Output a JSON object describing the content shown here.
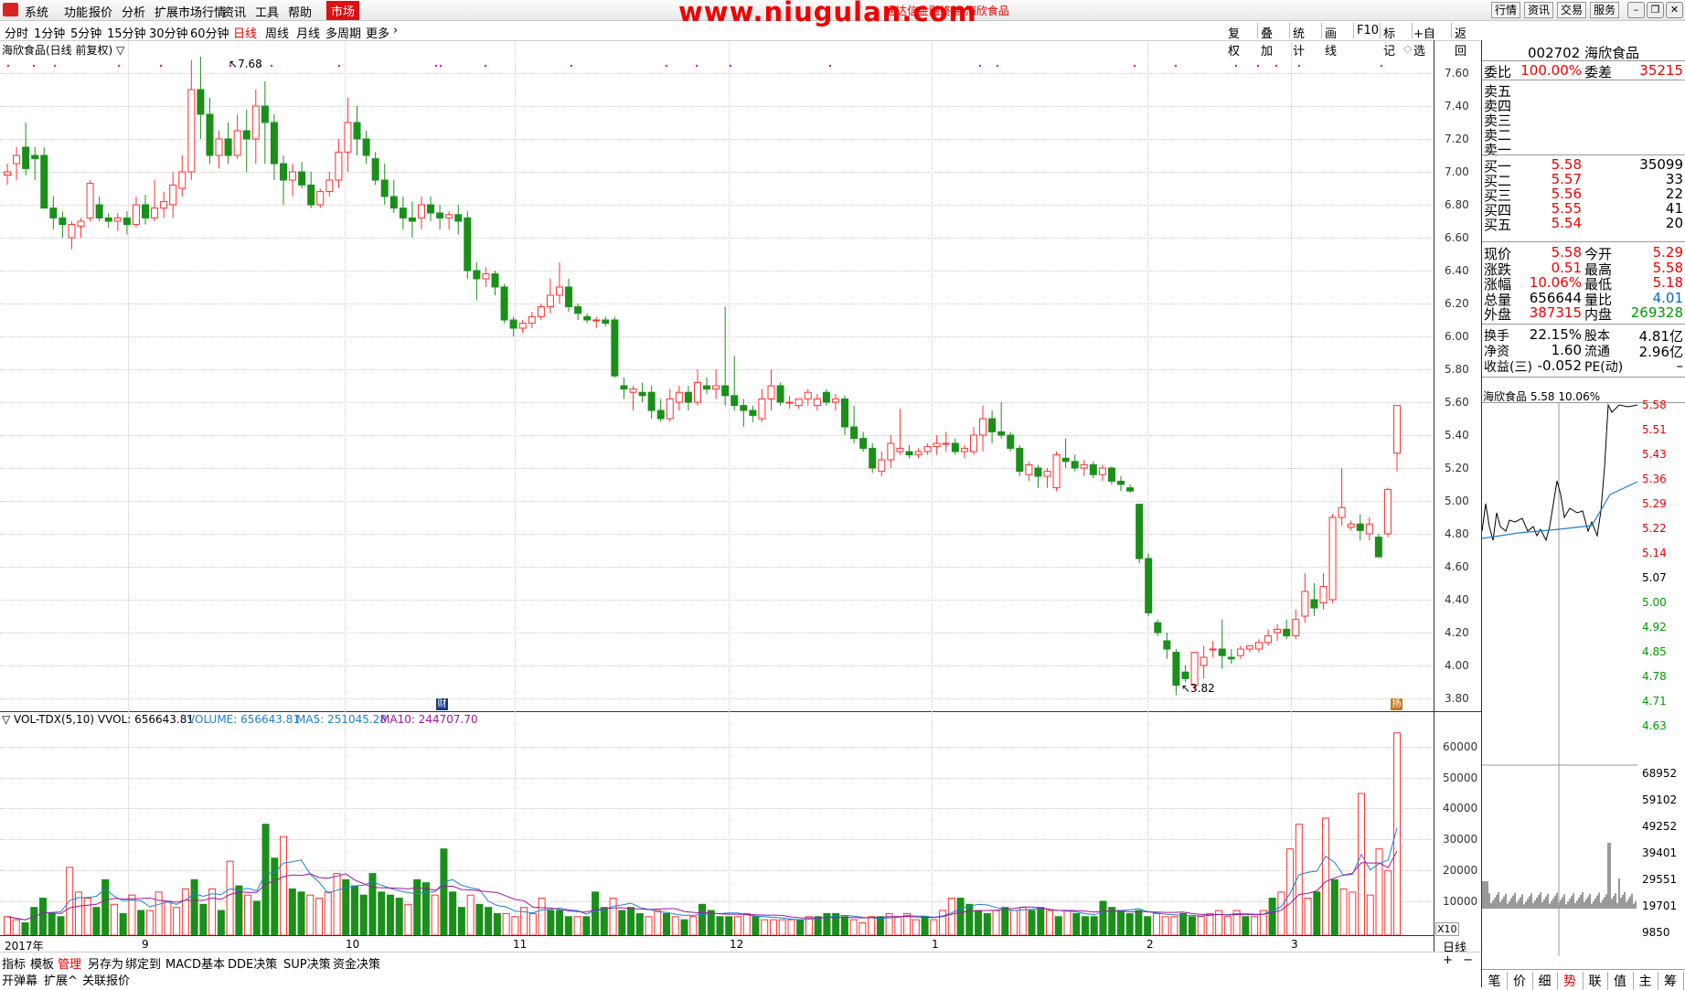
{
  "menu": {
    "items": [
      "系统",
      "功能",
      "报价",
      "分析",
      "扩展市场行情",
      "资讯",
      "工具",
      "帮助"
    ],
    "market": "市场",
    "watermark": "www.niugulan.com",
    "window_title": "通达信金融终端 海欣食品",
    "right_buttons": [
      "行情",
      "资讯",
      "交易",
      "服务"
    ]
  },
  "periods": {
    "items": [
      "分时",
      "1分钟",
      "5分钟",
      "15分钟",
      "30分钟",
      "60分钟",
      "日线",
      "周线",
      "月线",
      "多周期",
      "更多"
    ],
    "active": "日线"
  },
  "toolbar_right": [
    "复权",
    "叠加",
    "统计",
    "画线",
    "F10",
    "标记",
    "+自选",
    "返回"
  ],
  "main_chart": {
    "title": "海欣食品(日线 前复权) ▽",
    "high_label": "7.68",
    "low_label": "3.82",
    "y_ticks": [
      "7.60",
      "7.40",
      "7.20",
      "7.00",
      "6.80",
      "6.60",
      "6.40",
      "6.20",
      "6.00",
      "5.80",
      "5.60",
      "5.40",
      "5.20",
      "5.00",
      "4.80",
      "4.60",
      "4.40",
      "4.20",
      "4.00",
      "3.80"
    ],
    "badge1": "财",
    "badge2": "扬"
  },
  "chart_data": [
    {
      "type": "candlestick",
      "title": "海欣食品(日线 前复权)",
      "ylim": [
        3.75,
        7.72
      ],
      "candles": [
        [
          6.98,
          7.05,
          6.92,
          7.0
        ],
        [
          7.05,
          7.15,
          6.95,
          7.1
        ],
        [
          7.15,
          7.3,
          6.98,
          7.02
        ],
        [
          7.1,
          7.15,
          6.95,
          7.08
        ],
        [
          7.1,
          7.15,
          6.9,
          6.78
        ],
        [
          6.78,
          6.85,
          6.65,
          6.72
        ],
        [
          6.72,
          6.76,
          6.6,
          6.68
        ],
        [
          6.6,
          6.7,
          6.53,
          6.68
        ],
        [
          6.67,
          6.72,
          6.6,
          6.7
        ],
        [
          6.72,
          6.95,
          6.7,
          6.93
        ],
        [
          6.8,
          6.85,
          6.7,
          6.72
        ],
        [
          6.72,
          6.75,
          6.66,
          6.7
        ],
        [
          6.7,
          6.75,
          6.64,
          6.72
        ],
        [
          6.72,
          6.76,
          6.62,
          6.68
        ],
        [
          6.68,
          6.85,
          6.66,
          6.8
        ],
        [
          6.8,
          6.86,
          6.68,
          6.72
        ],
        [
          6.72,
          6.95,
          6.7,
          6.78
        ],
        [
          6.78,
          6.88,
          6.72,
          6.82
        ],
        [
          6.8,
          7.0,
          6.72,
          6.92
        ],
        [
          6.9,
          7.1,
          6.85,
          7.0
        ],
        [
          7.0,
          7.68,
          6.95,
          7.5
        ],
        [
          7.5,
          7.7,
          7.2,
          7.35
        ],
        [
          7.35,
          7.45,
          7.05,
          7.1
        ],
        [
          7.1,
          7.25,
          7.02,
          7.2
        ],
        [
          7.2,
          7.3,
          7.05,
          7.1
        ],
        [
          7.1,
          7.35,
          7.08,
          7.25
        ],
        [
          7.25,
          7.38,
          7.0,
          7.2
        ],
        [
          7.2,
          7.5,
          7.05,
          7.4
        ],
        [
          7.4,
          7.55,
          7.05,
          7.3
        ],
        [
          7.3,
          7.35,
          6.95,
          7.05
        ],
        [
          7.05,
          7.1,
          6.8,
          6.95
        ],
        [
          6.95,
          7.05,
          6.85,
          7.0
        ],
        [
          7.0,
          7.06,
          6.9,
          6.92
        ],
        [
          6.92,
          7.0,
          6.78,
          6.8
        ],
        [
          6.8,
          6.9,
          6.78,
          6.88
        ],
        [
          6.88,
          7.0,
          6.85,
          6.95
        ],
        [
          6.95,
          7.2,
          6.9,
          7.12
        ],
        [
          7.12,
          7.45,
          7.0,
          7.3
        ],
        [
          7.3,
          7.4,
          7.1,
          7.2
        ],
        [
          7.2,
          7.25,
          7.05,
          7.1
        ],
        [
          7.08,
          7.12,
          6.92,
          6.95
        ],
        [
          6.95,
          7.05,
          6.8,
          6.85
        ],
        [
          6.85,
          6.95,
          6.75,
          6.78
        ],
        [
          6.78,
          6.85,
          6.65,
          6.72
        ],
        [
          6.72,
          6.82,
          6.6,
          6.7
        ],
        [
          6.72,
          6.85,
          6.65,
          6.8
        ],
        [
          6.8,
          6.85,
          6.7,
          6.75
        ],
        [
          6.75,
          6.8,
          6.65,
          6.72
        ],
        [
          6.72,
          6.76,
          6.65,
          6.74
        ],
        [
          6.74,
          6.8,
          6.62,
          6.7
        ],
        [
          6.72,
          6.76,
          6.35,
          6.4
        ],
        [
          6.4,
          6.45,
          6.22,
          6.35
        ],
        [
          6.35,
          6.42,
          6.3,
          6.38
        ],
        [
          6.38,
          6.4,
          6.25,
          6.3
        ],
        [
          6.3,
          6.32,
          6.08,
          6.1
        ],
        [
          6.1,
          6.12,
          6.0,
          6.05
        ],
        [
          6.05,
          6.1,
          6.02,
          6.08
        ],
        [
          6.08,
          6.15,
          6.05,
          6.12
        ],
        [
          6.12,
          6.2,
          6.1,
          6.18
        ],
        [
          6.18,
          6.35,
          6.14,
          6.25
        ],
        [
          6.25,
          6.45,
          6.2,
          6.3
        ],
        [
          6.3,
          6.35,
          6.15,
          6.18
        ],
        [
          6.18,
          6.2,
          6.1,
          6.14
        ],
        [
          6.12,
          6.14,
          6.08,
          6.1
        ],
        [
          6.1,
          6.12,
          6.05,
          6.1
        ],
        [
          6.1,
          6.12,
          6.06,
          6.08
        ],
        [
          6.1,
          6.12,
          5.75,
          5.76
        ],
        [
          5.7,
          5.75,
          5.62,
          5.68
        ],
        [
          5.66,
          5.7,
          5.55,
          5.68
        ],
        [
          5.66,
          5.72,
          5.6,
          5.64
        ],
        [
          5.66,
          5.7,
          5.5,
          5.55
        ],
        [
          5.55,
          5.62,
          5.48,
          5.5
        ],
        [
          5.5,
          5.68,
          5.48,
          5.62
        ],
        [
          5.6,
          5.7,
          5.55,
          5.66
        ],
        [
          5.66,
          5.7,
          5.55,
          5.6
        ],
        [
          5.6,
          5.8,
          5.58,
          5.72
        ],
        [
          5.7,
          5.75,
          5.65,
          5.68
        ],
        [
          5.68,
          5.8,
          5.62,
          5.7
        ],
        [
          5.7,
          6.18,
          5.58,
          5.64
        ],
        [
          5.64,
          5.88,
          5.55,
          5.58
        ],
        [
          5.58,
          5.62,
          5.45,
          5.55
        ],
        [
          5.55,
          5.58,
          5.48,
          5.52
        ],
        [
          5.5,
          5.68,
          5.48,
          5.62
        ],
        [
          5.62,
          5.8,
          5.55,
          5.7
        ],
        [
          5.7,
          5.72,
          5.58,
          5.6
        ],
        [
          5.6,
          5.64,
          5.56,
          5.6
        ],
        [
          5.58,
          5.62,
          5.56,
          5.62
        ],
        [
          5.62,
          5.68,
          5.58,
          5.66
        ],
        [
          5.58,
          5.65,
          5.55,
          5.62
        ],
        [
          5.66,
          5.68,
          5.58,
          5.6
        ],
        [
          5.6,
          5.65,
          5.55,
          5.62
        ],
        [
          5.62,
          5.64,
          5.4,
          5.45
        ],
        [
          5.45,
          5.58,
          5.35,
          5.38
        ],
        [
          5.38,
          5.42,
          5.3,
          5.32
        ],
        [
          5.32,
          5.35,
          5.17,
          5.2
        ],
        [
          5.18,
          5.3,
          5.15,
          5.25
        ],
        [
          5.25,
          5.4,
          5.2,
          5.35
        ],
        [
          5.3,
          5.56,
          5.28,
          5.32
        ],
        [
          5.3,
          5.34,
          5.26,
          5.28
        ],
        [
          5.28,
          5.32,
          5.26,
          5.3
        ],
        [
          5.3,
          5.35,
          5.28,
          5.33
        ],
        [
          5.33,
          5.4,
          5.28,
          5.35
        ],
        [
          5.35,
          5.42,
          5.3,
          5.35
        ],
        [
          5.35,
          5.38,
          5.28,
          5.3
        ],
        [
          5.3,
          5.34,
          5.26,
          5.32
        ],
        [
          5.3,
          5.45,
          5.28,
          5.4
        ],
        [
          5.4,
          5.58,
          5.3,
          5.5
        ],
        [
          5.5,
          5.55,
          5.35,
          5.42
        ],
        [
          5.42,
          5.6,
          5.38,
          5.4
        ],
        [
          5.4,
          5.42,
          5.3,
          5.32
        ],
        [
          5.32,
          5.34,
          5.15,
          5.18
        ],
        [
          5.16,
          5.24,
          5.12,
          5.22
        ],
        [
          5.2,
          5.22,
          5.08,
          5.15
        ],
        [
          5.15,
          5.2,
          5.08,
          5.18
        ],
        [
          5.08,
          5.3,
          5.06,
          5.28
        ],
        [
          5.26,
          5.38,
          5.2,
          5.24
        ],
        [
          5.24,
          5.28,
          5.18,
          5.2
        ],
        [
          5.2,
          5.25,
          5.15,
          5.22
        ],
        [
          5.22,
          5.24,
          5.14,
          5.16
        ],
        [
          5.16,
          5.22,
          5.12,
          5.2
        ],
        [
          5.2,
          5.21,
          5.1,
          5.12
        ],
        [
          5.12,
          5.15,
          5.06,
          5.1
        ],
        [
          5.08,
          5.1,
          5.05,
          5.06
        ],
        [
          4.98,
          4.98,
          4.62,
          4.65
        ],
        [
          4.65,
          4.68,
          4.3,
          4.32
        ],
        [
          4.26,
          4.28,
          4.18,
          4.2
        ],
        [
          4.15,
          4.2,
          4.04,
          4.1
        ],
        [
          4.08,
          4.1,
          3.82,
          3.88
        ],
        [
          3.96,
          4.0,
          3.9,
          3.92
        ],
        [
          3.88,
          4.08,
          3.85,
          4.08
        ],
        [
          4.0,
          4.12,
          3.92,
          4.05
        ],
        [
          4.1,
          4.15,
          4.05,
          4.1
        ],
        [
          4.1,
          4.28,
          3.98,
          4.06
        ],
        [
          4.05,
          4.1,
          4.01,
          4.04
        ],
        [
          4.06,
          4.12,
          4.04,
          4.1
        ],
        [
          4.1,
          4.12,
          4.08,
          4.12
        ],
        [
          4.1,
          4.16,
          4.08,
          4.14
        ],
        [
          4.14,
          4.22,
          4.12,
          4.18
        ],
        [
          4.2,
          4.25,
          4.15,
          4.22
        ],
        [
          4.22,
          4.28,
          4.16,
          4.18
        ],
        [
          4.18,
          4.34,
          4.16,
          4.28
        ],
        [
          4.3,
          4.56,
          4.26,
          4.45
        ],
        [
          4.4,
          4.5,
          4.3,
          4.35
        ],
        [
          4.38,
          4.56,
          4.34,
          4.48
        ],
        [
          4.4,
          4.92,
          4.38,
          4.9
        ],
        [
          4.9,
          5.2,
          4.85,
          4.96
        ],
        [
          4.84,
          4.88,
          4.82,
          4.86
        ],
        [
          4.86,
          4.92,
          4.76,
          4.82
        ],
        [
          4.8,
          4.9,
          4.76,
          4.86
        ],
        [
          4.78,
          4.8,
          4.66,
          4.66
        ],
        [
          4.8,
          5.08,
          4.78,
          5.07
        ],
        [
          5.29,
          5.58,
          5.18,
          5.58
        ]
      ]
    },
    {
      "type": "bar",
      "title": "VOL-TDX(5,10)",
      "ylim": [
        0,
        68952
      ],
      "values": [
        6000,
        5000,
        4000,
        9000,
        12000,
        7000,
        6000,
        22000,
        14000,
        12000,
        9000,
        18000,
        10000,
        7000,
        13000,
        8000,
        8000,
        14000,
        11000,
        9000,
        15000,
        18000,
        10000,
        15000,
        8000,
        24000,
        16000,
        13000,
        11000,
        36000,
        25000,
        32000,
        15000,
        14000,
        13000,
        12000,
        14000,
        20000,
        18000,
        16000,
        13000,
        20000,
        14000,
        13000,
        12000,
        10000,
        18000,
        17000,
        13000,
        28000,
        14000,
        9000,
        13000,
        10000,
        9000,
        7000,
        7000,
        6000,
        9000,
        7000,
        12000,
        8000,
        8000,
        6000,
        6000,
        6000,
        14000,
        9000,
        12000,
        8000,
        9000,
        7000,
        6000,
        8000,
        7000,
        6000,
        5000,
        6000,
        10000,
        8000,
        6000,
        6000,
        6000,
        7000,
        6000,
        5000,
        5000,
        5000,
        5000,
        5000,
        6000,
        6000,
        7000,
        7000,
        6000,
        5000,
        4000,
        6000,
        6000,
        7000,
        6000,
        7000,
        5000,
        6000,
        5000,
        8000,
        12000,
        12000,
        10000,
        8000,
        7000,
        8000,
        9000,
        8000,
        9000,
        8000,
        9000,
        8000,
        6000,
        8000,
        7000,
        6000,
        6000,
        11000,
        9000,
        8000,
        7000,
        8000,
        6000,
        7000,
        6000,
        6000,
        7000,
        6000,
        6000,
        7000,
        8000,
        6000,
        8000,
        6000,
        6000,
        8000,
        12000,
        14000,
        28000,
        36000,
        12000,
        14000,
        38000,
        18000,
        15000,
        14000,
        46000,
        13000,
        28000,
        21000,
        65664
      ],
      "volume_label": "VOLUME: 656643.81",
      "ma5": 251045.28,
      "ma10": 244707.7
    }
  ],
  "volume_panel": {
    "title": "▽ VOL-TDX(5,10)  VVOL: 656643.81",
    "volume": "VOLUME: 656643.81",
    "ma5": "MA5: 251045.28",
    "ma10": "MA10: 244707.70",
    "y_ticks": [
      "60000",
      "50000",
      "40000",
      "30000",
      "20000",
      "10000"
    ],
    "unit": "X10"
  },
  "x_axis": {
    "labels": [
      "2017年",
      "9",
      "10",
      "11",
      "12",
      "1",
      "2",
      "3"
    ],
    "period": "日线"
  },
  "quote": {
    "code_name": "002702 海欣食品",
    "weibi_k": "委比",
    "weibi_v": "100.00%",
    "weicha_k": "委差",
    "weicha_v": "35215",
    "sell": [
      {
        "k": "卖五",
        "p": "",
        "v": ""
      },
      {
        "k": "卖四",
        "p": "",
        "v": ""
      },
      {
        "k": "卖三",
        "p": "",
        "v": ""
      },
      {
        "k": "卖二",
        "p": "",
        "v": ""
      },
      {
        "k": "卖一",
        "p": "",
        "v": ""
      }
    ],
    "buy": [
      {
        "k": "买一",
        "p": "5.58",
        "v": "35099"
      },
      {
        "k": "买二",
        "p": "5.57",
        "v": "33"
      },
      {
        "k": "买三",
        "p": "5.56",
        "v": "22"
      },
      {
        "k": "买四",
        "p": "5.55",
        "v": "41"
      },
      {
        "k": "买五",
        "p": "5.54",
        "v": "20"
      }
    ],
    "stats": [
      {
        "k1": "现价",
        "v1": "5.58",
        "k2": "今开",
        "v2": "5.29"
      },
      {
        "k1": "涨跌",
        "v1": "0.51",
        "k2": "最高",
        "v2": "5.58"
      },
      {
        "k1": "涨幅",
        "v1": "10.06%",
        "k2": "最低",
        "v2": "5.18"
      },
      {
        "k1": "总量",
        "v1": "656644",
        "k2": "量比",
        "v2": "4.01"
      },
      {
        "k1": "外盘",
        "v1": "387315",
        "k2": "内盘",
        "v2": "269328"
      }
    ],
    "stats2": [
      {
        "k1": "换手",
        "v1": "22.15%",
        "k2": "股本",
        "v2": "4.81亿"
      },
      {
        "k1": "净资",
        "v1": "1.60",
        "k2": "流通",
        "v2": "2.96亿"
      },
      {
        "k1": "收益(三)",
        "v1": "-0.052",
        "k2": "PE(动)",
        "v2": "–"
      }
    ]
  },
  "mini_chart": {
    "title": "海欣食品  5.58  10.06%",
    "price_ticks": [
      "5.58",
      "5.51",
      "5.43",
      "5.36",
      "5.29",
      "5.22",
      "5.14",
      "5.07",
      "5.00",
      "4.92",
      "4.85",
      "4.78",
      "4.71",
      "4.63"
    ],
    "vol_ticks": [
      "68952",
      "59102",
      "49252",
      "39401",
      "29551",
      "19701",
      "9850"
    ]
  },
  "bottom_tabs": [
    "指标",
    "模板",
    "管理",
    "另存为",
    "绑定到",
    "MACD基本",
    "DDE决策",
    "SUP决策",
    "资金决策"
  ],
  "bottom_tabs2": [
    "开弹幕",
    "扩展^",
    "关联报价"
  ],
  "right_bottom_tabs": [
    "笔",
    "价",
    "细",
    "势",
    "联",
    "值",
    "主",
    "筹"
  ],
  "colors": {
    "up": "#ff3030",
    "down": "#1a8f1a",
    "ma5": "#1e7fd6",
    "ma10": "#a0179c",
    "accent": "#e00000"
  }
}
